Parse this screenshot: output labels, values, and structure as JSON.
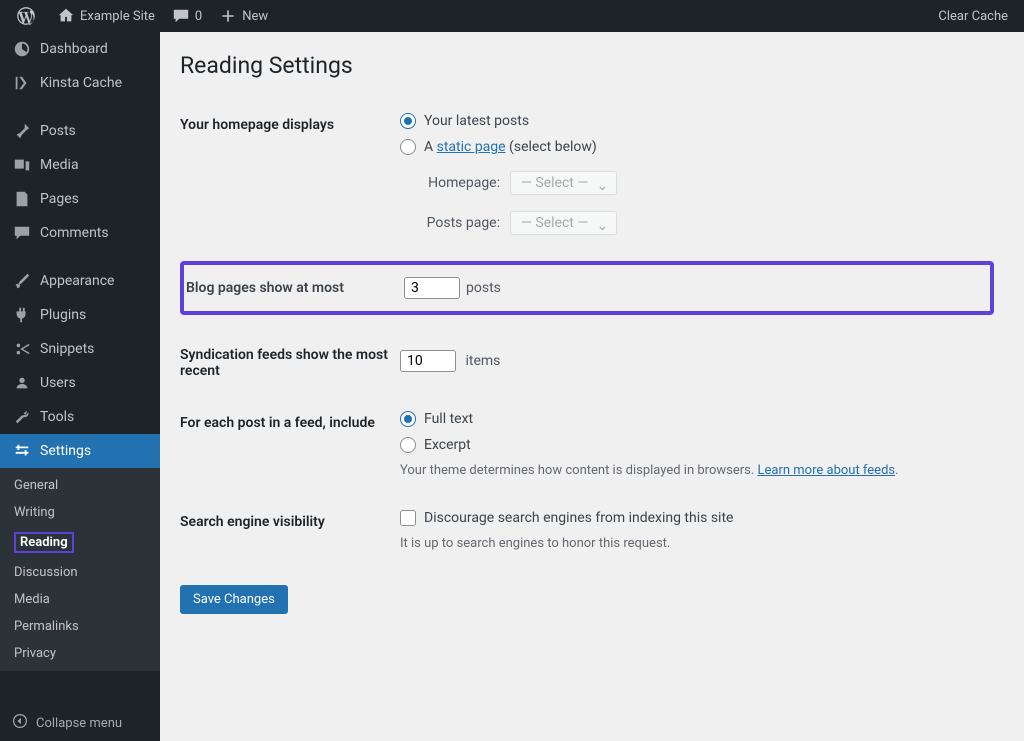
{
  "adminbar": {
    "site": "Example Site",
    "comments": "0",
    "new": "New",
    "clear": "Clear Cache"
  },
  "sidebar": {
    "dashboard": "Dashboard",
    "kinsta": "Kinsta Cache",
    "posts": "Posts",
    "media": "Media",
    "pages": "Pages",
    "comments": "Comments",
    "appearance": "Appearance",
    "plugins": "Plugins",
    "snippets": "Snippets",
    "users": "Users",
    "tools": "Tools",
    "settings": "Settings",
    "collapse": "Collapse menu"
  },
  "submenu": {
    "general": "General",
    "writing": "Writing",
    "reading": "Reading",
    "discussion": "Discussion",
    "media": "Media",
    "permalinks": "Permalinks",
    "privacy": "Privacy"
  },
  "page": {
    "title": "Reading Settings",
    "homepage_label": "Your homepage displays",
    "latest_posts": "Your latest posts",
    "static_a": "A ",
    "static_link": "static page",
    "static_tail": " (select below)",
    "homepage_select_label": "Homepage:",
    "postspage_select_label": "Posts page:",
    "select_placeholder": "— Select —",
    "blog_pages_label": "Blog pages show at most",
    "blog_pages_value": "3",
    "blog_pages_unit": "posts",
    "syndication_label": "Syndication feeds show the most recent",
    "syndication_value": "10",
    "syndication_unit": "items",
    "feed_label": "For each post in a feed, include",
    "feed_full": "Full text",
    "feed_excerpt": "Excerpt",
    "feed_desc_a": "Your theme determines how content is displayed in browsers. ",
    "feed_desc_link": "Learn more about feeds",
    "visibility_label": "Search engine visibility",
    "discourage": "Discourage search engines from indexing this site",
    "visibility_desc": "It is up to search engines to honor this request.",
    "save": "Save Changes"
  }
}
